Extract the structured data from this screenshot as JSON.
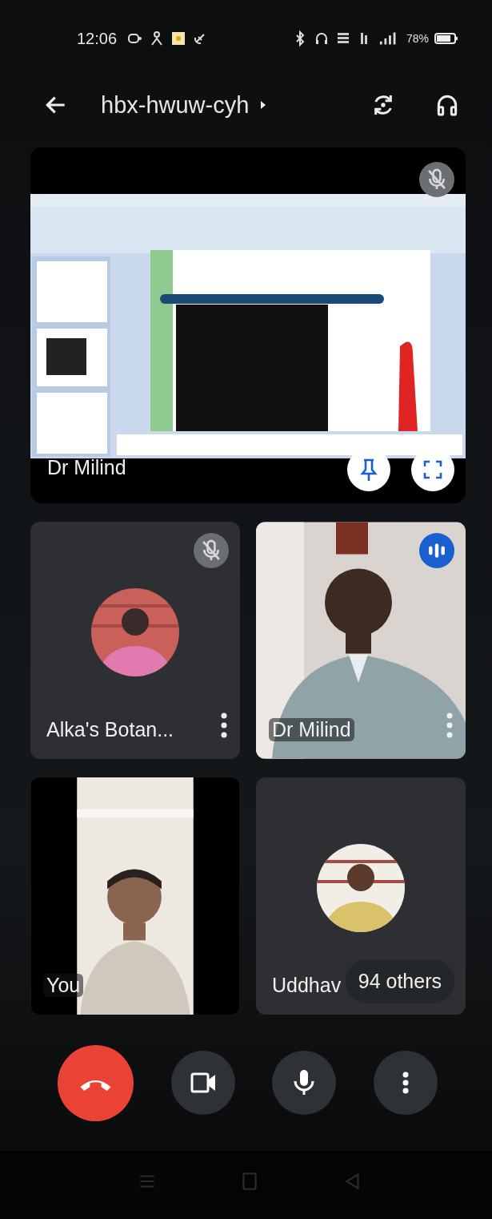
{
  "status_bar": {
    "time": "12:06",
    "battery": "78%"
  },
  "app_bar": {
    "meeting_code": "hbx-hwuw-cyh"
  },
  "presentation": {
    "presenter": "Dr Milind",
    "muted": true
  },
  "participants": [
    {
      "name": "Alka's Botan...",
      "kind": "avatar",
      "muted": true,
      "speaking": false,
      "menu": true
    },
    {
      "name": "Dr Milind",
      "kind": "video",
      "muted": false,
      "speaking": true,
      "menu": true
    },
    {
      "name": "You",
      "kind": "self",
      "muted": false,
      "speaking": false,
      "menu": false
    },
    {
      "name": "Uddhav",
      "kind": "avatar",
      "muted": false,
      "speaking": false,
      "menu": false,
      "others": "94 others"
    }
  ],
  "controls": [
    {
      "kind": "hangup"
    },
    {
      "kind": "camera"
    },
    {
      "kind": "mic"
    },
    {
      "kind": "more"
    }
  ]
}
